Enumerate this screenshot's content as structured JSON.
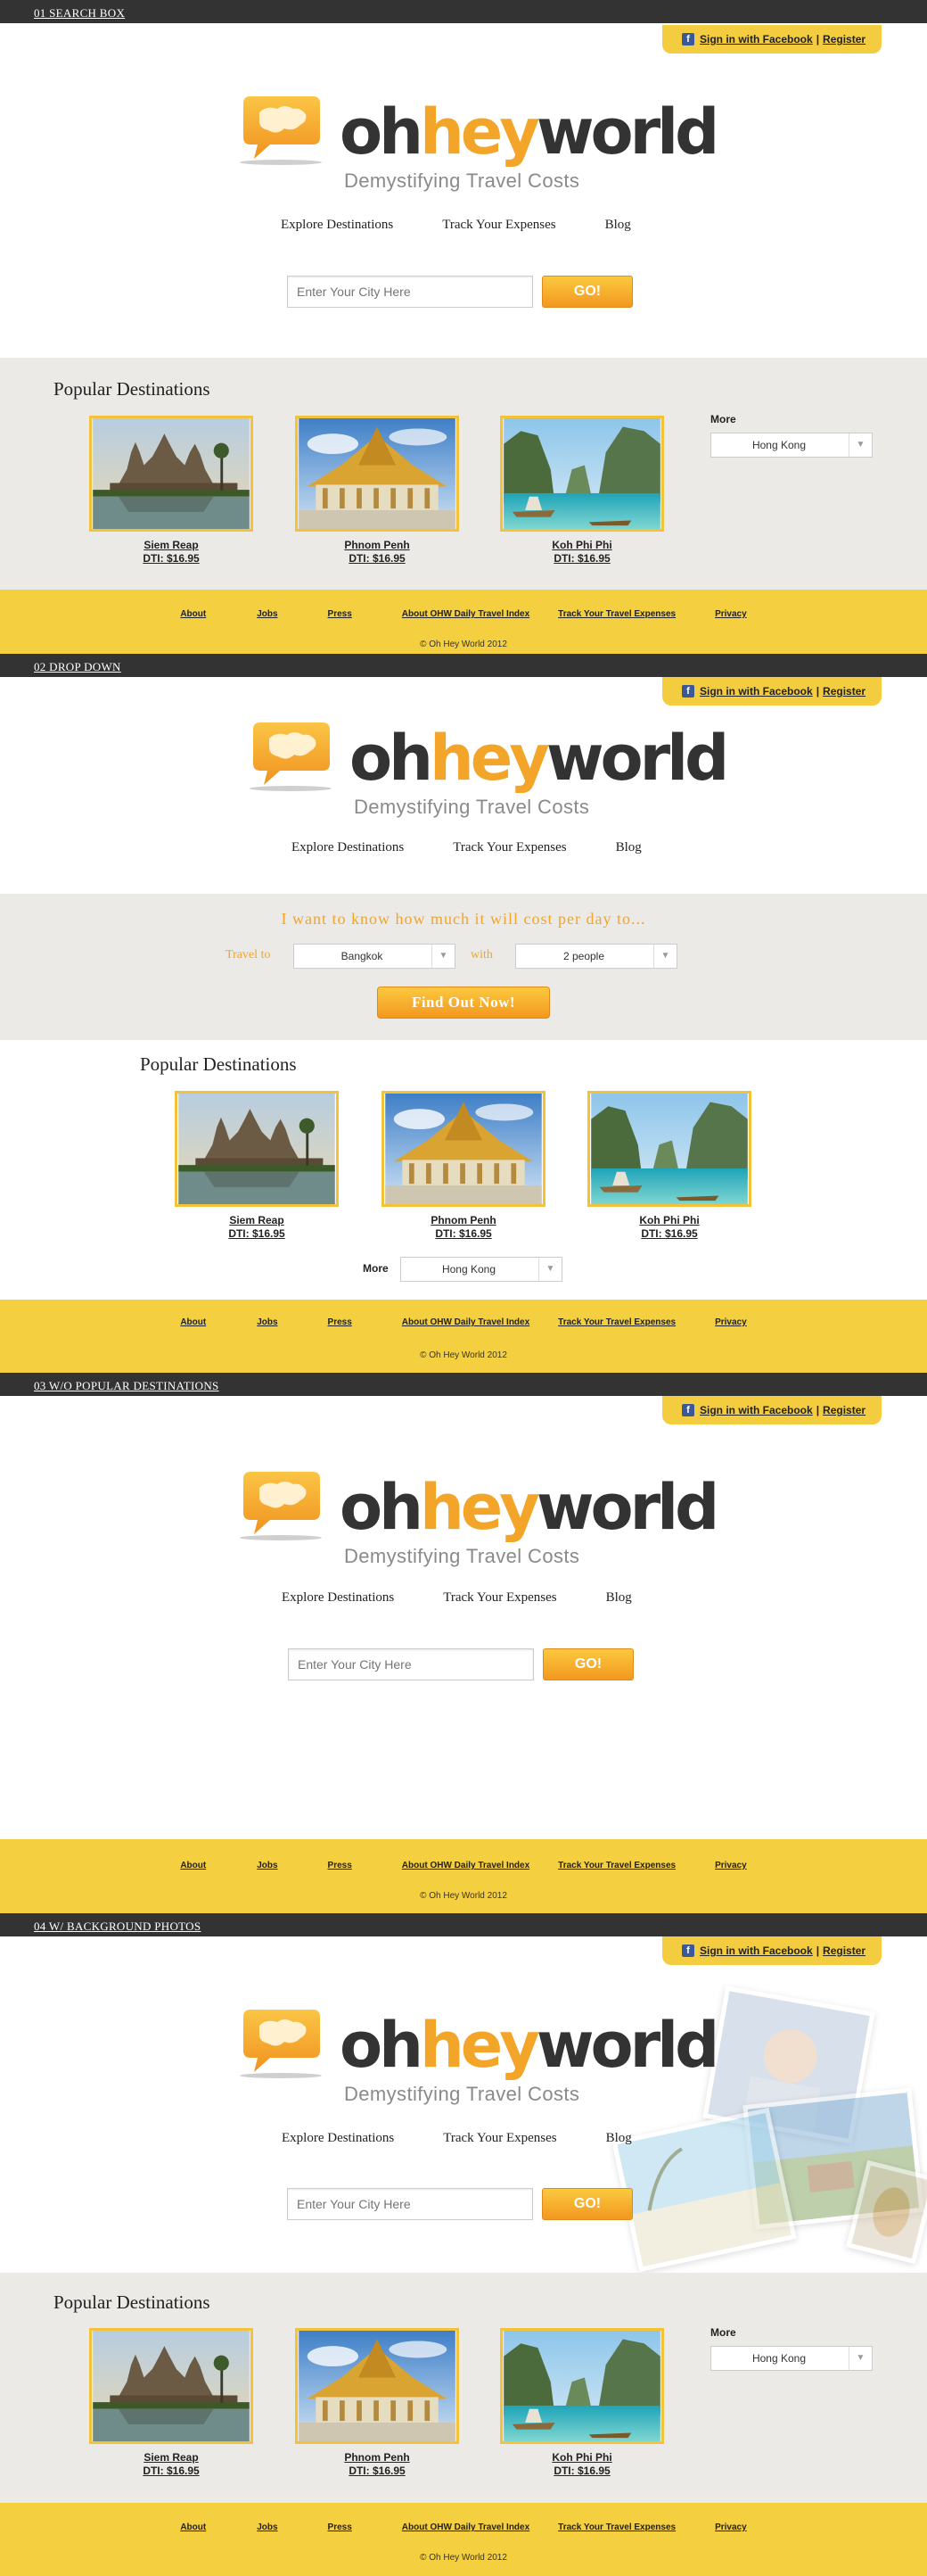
{
  "sections": [
    {
      "label": "01 SEARCH BOX"
    },
    {
      "label": "02 DROP DOWN"
    },
    {
      "label": "03 W/O POPULAR DESTINATIONS"
    },
    {
      "label": "04 W/ BACKGROUND PHOTOS"
    }
  ],
  "header": {
    "facebook_signin": "Sign in with Facebook",
    "separator": "|",
    "register": "Register"
  },
  "logo": {
    "oh": "oh",
    "hey": "hey",
    "world": "world",
    "tagline": "Demystifying Travel Costs"
  },
  "nav": {
    "explore": "Explore Destinations",
    "track": "Track Your Expenses",
    "blog": "Blog"
  },
  "search": {
    "placeholder": "Enter Your City Here",
    "go_label": "GO!"
  },
  "popular": {
    "title": "Popular Destinations",
    "destinations": [
      {
        "name": "Siem Reap",
        "dti": "DTI: $16.95"
      },
      {
        "name": "Phnom Penh",
        "dti": "DTI: $16.95"
      },
      {
        "name": "Koh Phi Phi",
        "dti": "DTI: $16.95"
      }
    ],
    "more_label": "More",
    "more_value": "Hong Kong"
  },
  "dropdown_form": {
    "question": "I want to know how much it will cost per day to...",
    "travel_to_label": "Travel to",
    "travel_to_value": "Bangkok",
    "with_label": "with",
    "with_value": "2 people",
    "submit_label": "Find Out Now!"
  },
  "footer": {
    "links": [
      "About",
      "Jobs",
      "Press",
      "About OHW Daily Travel Index",
      "Track Your Travel Expenses",
      "Privacy"
    ],
    "copyright": "© Oh Hey World 2012"
  },
  "colors": {
    "accent_orange": "#f3a52a",
    "band_yellow": "#f4cf3f",
    "section_bar": "#333333",
    "grey_band": "#ebeae7",
    "facebook_blue": "#3b5998"
  }
}
